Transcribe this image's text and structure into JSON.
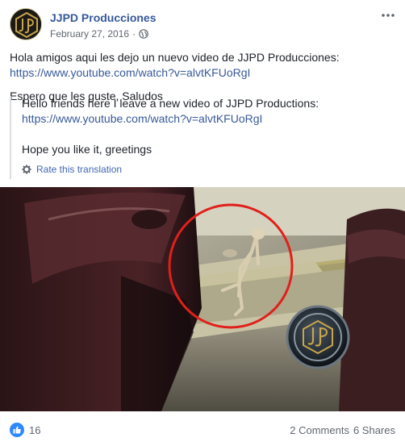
{
  "post": {
    "page_name": "JJPD Producciones",
    "date": "February 27, 2016",
    "separator": "·",
    "privacy_icon": "globe-icon",
    "more_icon": "more-options-icon"
  },
  "content": {
    "line1": "Hola amigos aqui les dejo un nuevo video de JJPD Producciones:",
    "link1": "https://www.youtube.com/watch?v=alvtKFUoRgI",
    "line2": "Espero que les guste, Saludos"
  },
  "translation": {
    "line1": "Hello friends here I leave a new video of JJPD Productions:",
    "link1": "https://www.youtube.com/watch?v=alvtKFUoRgI",
    "line2": "Hope you like it, greetings",
    "rate_label": "Rate this translation",
    "gear_icon": "gear-icon"
  },
  "media": {
    "watermark": "JJPD",
    "highlight_color": "#e0201b"
  },
  "footer": {
    "like_count": "16",
    "comments": "2 Comments",
    "shares": "6 Shares",
    "like_icon": "thumbs-up-icon"
  },
  "colors": {
    "link": "#385898",
    "page_name": "#365899",
    "like_blue": "#2e89ff"
  }
}
